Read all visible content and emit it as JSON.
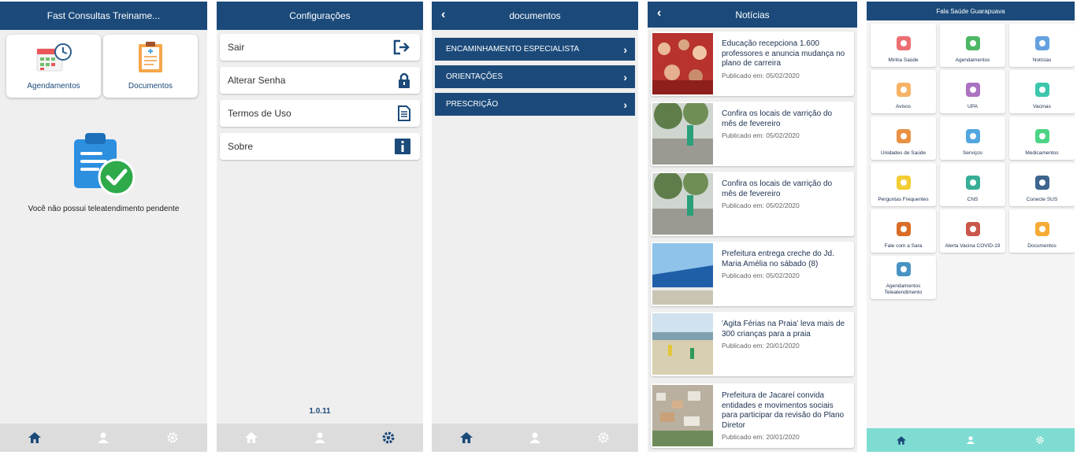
{
  "screen1": {
    "title": "Fast Consultas Treiname...",
    "tiles": [
      {
        "label": "Agendamentos",
        "icon": "calendar-clock-icon"
      },
      {
        "label": "Documentos",
        "icon": "clipboard-icon"
      }
    ],
    "empty_message": "Você não possui teleatendimento pendente",
    "nav": [
      "home-icon",
      "user-icon",
      "gear-icon"
    ]
  },
  "screen2": {
    "title": "Configurações",
    "items": [
      {
        "label": "Sair",
        "icon": "logout-icon"
      },
      {
        "label": "Alterar Senha",
        "icon": "lock-icon"
      },
      {
        "label": "Termos de Uso",
        "icon": "document-icon"
      },
      {
        "label": "Sobre",
        "icon": "info-icon"
      }
    ],
    "version": "1.0.11"
  },
  "screen3": {
    "title": "documentos",
    "items": [
      {
        "label": "ENCAMINHAMENTO ESPECIALISTA"
      },
      {
        "label": "ORIENTAÇÕES"
      },
      {
        "label": "PRESCRIÇÃO"
      }
    ]
  },
  "screen4": {
    "title": "Notícias",
    "news": [
      {
        "title": "Educação recepciona 1.600 professores e anuncia mudança no plano de carreira",
        "date": "Publicado em: 05/02/2020"
      },
      {
        "title": "Confira os locais de varrição do mês de fevereiro",
        "date": "Publicado em: 05/02/2020"
      },
      {
        "title": "Confira os locais de varrição do mês de fevereiro",
        "date": "Publicado em: 05/02/2020"
      },
      {
        "title": "Prefeitura entrega creche do Jd. Maria Amélia no sábado (8)",
        "date": "Publicado em: 05/02/2020"
      },
      {
        "title": "'Agita Férias na Praia' leva mais de 300 crianças para a praia",
        "date": "Publicado em: 20/01/2020"
      },
      {
        "title": "Prefeitura de Jacareí convida entidades e movimentos sociais para participar da revisão do Plano Diretor",
        "date": "Publicado em: 20/01/2020"
      }
    ]
  },
  "screen5": {
    "title": "Fala Saúde Guarapuava",
    "tiles": [
      {
        "label": "Minha Saúde",
        "icon": "heart-hand-icon"
      },
      {
        "label": "Agendamentos",
        "icon": "calendar-icon"
      },
      {
        "label": "Notícias",
        "icon": "newspaper-icon"
      },
      {
        "label": "Avisos",
        "icon": "megaphone-icon"
      },
      {
        "label": "UPA",
        "icon": "hospital-icon"
      },
      {
        "label": "Vacinas",
        "icon": "syringe-icon"
      },
      {
        "label": "Unidades de Saúde",
        "icon": "health-unit-icon"
      },
      {
        "label": "Serviços",
        "icon": "services-icon"
      },
      {
        "label": "Medicamentos",
        "icon": "pills-icon"
      },
      {
        "label": "Perguntas Frequentes",
        "icon": "question-icon"
      },
      {
        "label": "CNS",
        "icon": "card-icon"
      },
      {
        "label": "Conecte SUS",
        "icon": "phone-app-icon"
      },
      {
        "label": "Fale com a Sara",
        "icon": "assistant-icon"
      },
      {
        "label": "Alerta Vacina COVID-19",
        "icon": "vaccine-alert-icon"
      },
      {
        "label": "Documentos",
        "icon": "clipboard-icon"
      },
      {
        "label": "Agendamentos Teleatendimento",
        "icon": "calendar-clock-icon"
      }
    ]
  },
  "colors": {
    "primary": "#1b4a7a",
    "accent_nav": "#7fdcd3",
    "check_green": "#2eaa4a"
  }
}
